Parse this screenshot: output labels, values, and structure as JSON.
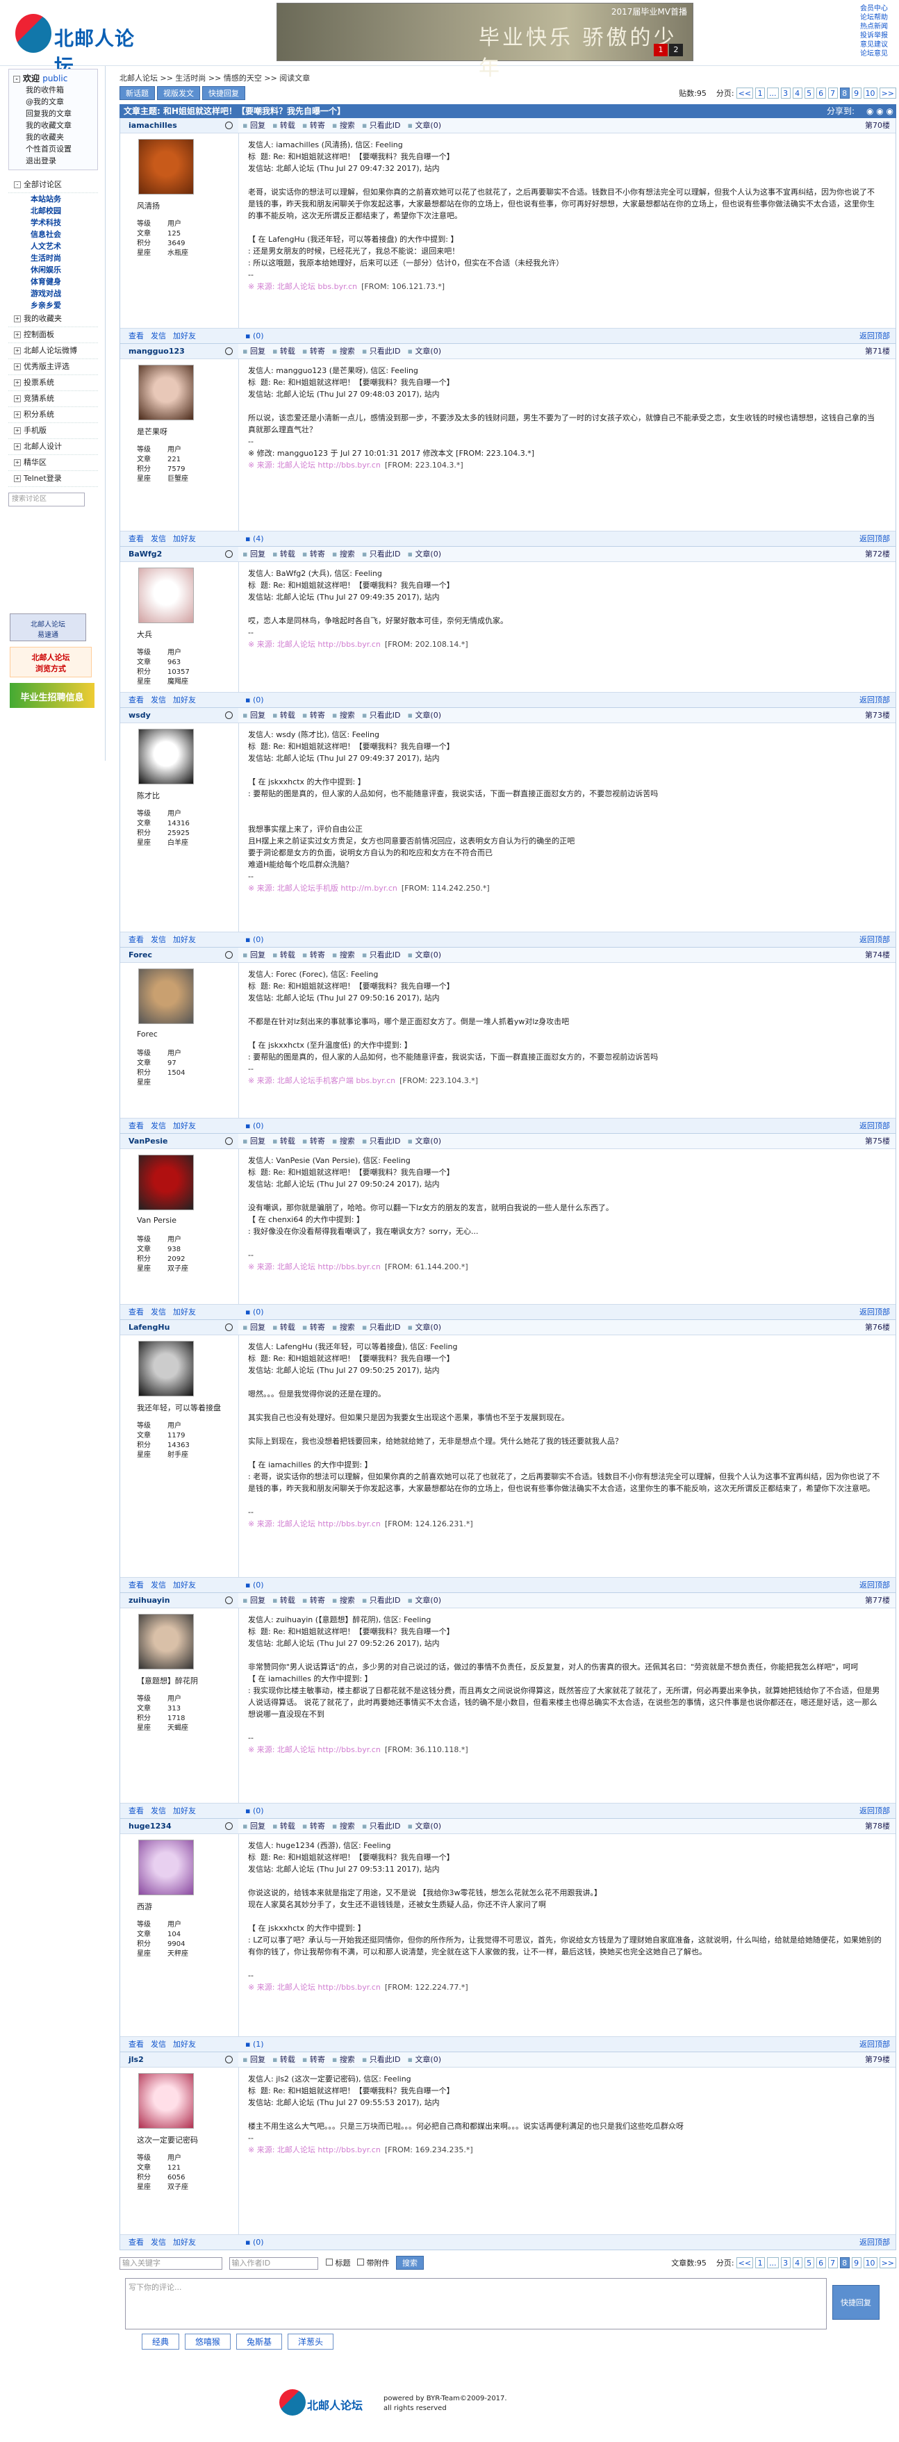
{
  "site": {
    "logo_text": "北邮人论坛",
    "banner_title": "毕业快乐  骄傲的少年",
    "banner_sub": "2017届毕业MV首播",
    "banner_p1": "1",
    "banner_p2": "2"
  },
  "toplinks": [
    "会员中心",
    "论坛帮助",
    "热点新闻",
    "投诉举报",
    "意见建议",
    "论坛意见"
  ],
  "side": {
    "welcome": "欢迎",
    "user": "public",
    "links": [
      "我的收件箱",
      "@我的文章",
      "回复我的文章",
      "我的收藏文章",
      "我的收藏夹",
      "个性首页设置",
      "退出登录"
    ],
    "all": "全部讨论区",
    "subs": [
      "本站站务",
      "北邮校园",
      "学术科技",
      "信息社会",
      "人文艺术",
      "生活时尚",
      "休闲娱乐",
      "体育健身",
      "游戏对战",
      "乡亲乡爱"
    ],
    "sections": [
      "我的收藏夹",
      "控制面板",
      "北邮人论坛微博",
      "优秀版主评选",
      "投票系统",
      "竞猜系统",
      "积分系统",
      "手机版",
      "北邮人设计",
      "精华区",
      "Telnet登录"
    ],
    "search_ph": "搜索讨论区",
    "promo1": "北邮人论坛\n易速通",
    "promo2": "北邮人论坛\n浏览方式",
    "promo3": "毕业生招聘信息"
  },
  "crumb": "北邮人论坛  >>  生活时尚  >>  情感的天空  >>  阅读文章",
  "toolbar": {
    "b1": "新话题",
    "b2": "视版发文",
    "b3": "快捷回复",
    "count": "贴数:95",
    "pages_label": "分页:",
    "pages": [
      "<<",
      "1",
      "...",
      "3",
      "4",
      "5",
      "6",
      "7",
      "8",
      "9",
      "10",
      ">>"
    ]
  },
  "title": {
    "text": "文章主题: 和H姐姐就这样吧！【要嘲我料？我先自曝一个】",
    "share": "分享到:"
  },
  "actions": [
    "回复",
    "转载",
    "转寄",
    "搜索",
    "只看此ID",
    "文章(0)"
  ],
  "footer_actions": [
    "查看",
    "发信",
    "加好友"
  ],
  "back": "返回顶部",
  "posts": [
    {
      "name": "iamachilles",
      "floor": "第70楼",
      "nick": "风清扬",
      "level": "用户",
      "posts": "125",
      "score": "3649",
      "star": "水瓶座",
      "fav": "(0)",
      "text": "发信人: iamachilles (风清扬), 信区: Feeling\n标  题: Re: 和H姐姐就这样吧！【要嘲我料？我先自曝一个】\n发信站: 北邮人论坛 (Thu Jul 27 09:47:32 2017), 站内\n\n老哥，说实话你的想法可以理解，但如果你真的之前喜欢她可以花了也就花了，之后再要聊实不合适。钱数目不小你有想法完全可以理解，但我个人认为这事不宜再纠结，因为你也说了不是钱的事，昨天我和朋友闲聊关于你发起这事，大家最想都站在你的立场上，但也说有些事，你可再好好想想，大家最想都站在你的立场上，但也说有些事你做法确实不太合适，这里你生的事不能反响，这次无所谓反正都结束了，希望你下次注意吧。\n\n【 在 LafengHu (我还年轻，可以等着接盘) 的大作中提到: 】\n: 还是男女朋友的时候，已经花光了，我总不能说：退回来吧！\n: 所以这哦题，我原本给她理好，后来可以还（一部分）估计0，但实在不合适（未经我允许）\n--",
      "src": "※ 来源: 北邮人论坛 bbs.byr.cn",
      "ip": "[FROM: 106.121.73.*]"
    },
    {
      "name": "mangguo123",
      "floor": "第71楼",
      "nick": "是芒果呀",
      "level": "用户",
      "posts": "221",
      "score": "7579",
      "star": "巨蟹座",
      "fav": "(4)",
      "text": "发信人: mangguo123 (是芒果呀), 信区: Feeling\n标  题: Re: 和H姐姐就这样吧！【要嘲我料？我先自曝一个】\n发信站: 北邮人论坛 (Thu Jul 27 09:48:03 2017), 站内\n\n所以说，该恋爱还是小清新一点儿，感情没到那一步，不要涉及太多的钱财问题，男生不要为了一时的讨女孩子欢心，就慷自己不能承受之恋，女生收钱的时候也请想想，这钱自己拿的当真就那么理直气壮？\n--\n※ 修改: mangguo123 于 Jul 27 10:01:31 2017 修改本文 [FROM: 223.104.3.*]",
      "src": "※ 来源: 北邮人论坛 http://bbs.byr.cn",
      "ip": "[FROM: 223.104.3.*]"
    },
    {
      "name": "BaWfg2",
      "floor": "第72楼",
      "nick": "大兵",
      "level": "用户",
      "posts": "963",
      "score": "10357",
      "star": "魔羯座",
      "fav": "(0)",
      "text": "发信人: BaWfg2 (大兵), 信区: Feeling\n标  题: Re: 和H姐姐就这样吧！【要嘲我料？我先自曝一个】\n发信站: 北邮人论坛 (Thu Jul 27 09:49:35 2017), 站内\n\n哎，恋人本是同林鸟，争啥起时各自飞，好聚好散本可佳，奈何无情成仇家。\n--",
      "src": "※ 来源: 北邮人论坛 http://bbs.byr.cn",
      "ip": "[FROM: 202.108.14.*]"
    },
    {
      "name": "wsdy",
      "floor": "第73楼",
      "nick": "陈才比",
      "level": "用户",
      "posts": "14316",
      "score": "25925",
      "star": "白羊座",
      "fav": "(0)",
      "text": "发信人: wsdy (陈才比), 信区: Feeling\n标  题: Re: 和H姐姐就这样吧！【要嘲我料？我先自曝一个】\n发信站: 北邮人论坛 (Thu Jul 27 09:49:37 2017), 站内\n\n【 在 jskxxhctx 的大作中提到: 】\n: 要帮贴的图是真的，但人家的人品如何，也不能随意评查，我说实话，下面一群直接正面怼女方的，不要忽视前边诉苦吗\n\n\n我想事实摆上来了，评价自由公正\n且H摆上来之前证实过女方贵足，女方也同意要否前情况回应，这表明女方自认为行的确坐的正吧\n要于洞论都是女方的负面，说明女方自认为的和吃应和女方在不符合而已\n难道H能给每个吃瓜群众洗脑？\n--",
      "src": "※ 来源: 北邮人论坛手机版 http://m.byr.cn",
      "ip": "[FROM: 114.242.250.*]"
    },
    {
      "name": "Forec",
      "floor": "第74楼",
      "nick": "Forec",
      "level": "用户",
      "posts": "97",
      "score": "1504",
      "star": "",
      "fav": "(0)",
      "text": "发信人: Forec (Forec), 信区: Feeling\n标  题: Re: 和H姐姐就这样吧！【要嘲我料？我先自曝一个】\n发信站: 北邮人论坛 (Thu Jul 27 09:50:16 2017), 站内\n\n不都是在针对lz刻出来的事就事论事吗，哪个是正面怼女方了。倒是一堆人抓着yw对lz身攻击吧\n\n【 在 jskxxhctx (至升温度低) 的大作中提到: 】\n: 要帮贴的图是真的，但人家的人品如何，也不能随意评查，我说实话，下面一群直接正面怼女方的，不要忽视前边诉苦吗\n--",
      "src": "※ 来源: 北邮人论坛手机客户端 bbs.byr.cn",
      "ip": "[FROM: 223.104.3.*]"
    },
    {
      "name": "VanPesie",
      "floor": "第75楼",
      "nick": "Van Persie",
      "level": "用户",
      "posts": "938",
      "score": "2092",
      "star": "双子座",
      "fav": "(0)",
      "text": "发信人: VanPesie (Van Persie), 信区: Feeling\n标  题: Re: 和H姐姐就这样吧！【要嘲我料？我先自曝一个】\n发信站: 北邮人论坛 (Thu Jul 27 09:50:24 2017), 站内\n\n没有嘲讽，那你就是骗朋了，哈哈。你可以翻一下lz女方的朋友的发言，就明白我说的一些人是什么东西了。\n【 在 chenxi64 的大作中提到: 】\n: 我好像没在你没看帮得我看嘲讽了，我在嘲讽女方？sorry，无心...\n\n--",
      "src": "※ 来源: 北邮人论坛 http://bbs.byr.cn",
      "ip": "[FROM: 61.144.200.*]"
    },
    {
      "name": "LafengHu",
      "floor": "第76楼",
      "nick": "我还年轻，可以等着接盘",
      "level": "用户",
      "posts": "1179",
      "score": "14363",
      "star": "射手座",
      "fav": "(0)",
      "text": "发信人: LafengHu (我还年轻，可以等着接盘), 信区: Feeling\n标  题: Re: 和H姐姐就这样吧！【要嘲我料？我先自曝一个】\n发信站: 北邮人论坛 (Thu Jul 27 09:50:25 2017), 站内\n\n嗯然。。。但是我觉得你说的还是在理的。\n\n其实我自己也没有处理好。但如果只是因为我要女生出现这个恶果，事情也不至于发展到现在。\n\n实际上到现在，我也没想着把钱要回来，给她就给她了，无非是想点个理。凭什么她花了我的钱还要就我人品？\n\n【 在 iamachilles 的大作中提到: 】\n: 老哥，说实话你的想法可以理解，但如果你真的之前喜欢她可以花了也就花了，之后再要聊实不合适。钱数目不小你有想法完全可以理解，但我个人认为这事不宜再纠结，因为你也说了不是钱的事，昨天我和朋友闲聊关于你发起这事，大家最想都站在你的立场上，但也说有些事你做法确实不太合适，这里你生的事不能反响，这次无所谓反正都结束了，希望你下次注意吧。\n\n--",
      "src": "※ 来源: 北邮人论坛 http://bbs.byr.cn",
      "ip": "[FROM: 124.126.231.*]"
    },
    {
      "name": "zuihuayin",
      "floor": "第77楼",
      "nick": "【意题想】醉花阴",
      "level": "用户",
      "posts": "313",
      "score": "1718",
      "star": "天蝎座",
      "fav": "(0)",
      "text": "发信人: zuihuayin (【意题想】醉花阴), 信区: Feeling\n标  题: Re: 和H姐姐就这样吧！【要嘲我料？我先自曝一个】\n发信站: 北邮人论坛 (Thu Jul 27 09:52:26 2017), 站内\n\n非常赞同你\"男人说话算话\"的点，多少男的对自己说过的话，做过的事情不负责任，反反复复，对人的伤害真的很大。还佩其名曰：\"劳资就是不想负责任，你能把我怎么样吧\"，呵呵\n【 在 iamachilles 的大作中提到: 】\n: 我实现你比楼主敏事动，楼主都说了日都花就不是这钱分费，而且再女之间说说你得算这，既然答应了大家就花了就花了，无所谓，何必再要出来争执，就算她把钱给你了不合适，但是男人说话得算话。 说花了就花了，此时再要她还事情买不太合适，钱的确不是小数目，但看来楼主也得总确实不太合适，在说些怎的事情，这只件事是也说你都还在，嗯还是好话，这一那么想说哪一直没现在不到\n\n--",
      "src": "※ 来源: 北邮人论坛 http://bbs.byr.cn",
      "ip": "[FROM: 36.110.118.*]"
    },
    {
      "name": "huge1234",
      "floor": "第78楼",
      "nick": "西游",
      "level": "用户",
      "posts": "104",
      "score": "9904",
      "star": "天秤座",
      "fav": "(1)",
      "text": "发信人: huge1234 (西游), 信区: Feeling\n标  题: Re: 和H姐姐就这样吧！【要嘲我料？我先自曝一个】\n发信站: 北邮人论坛 (Thu Jul 27 09:53:11 2017), 站内\n\n你说这说的，给钱本来就是指定了用途，又不是说 【我给你3w零花钱，想怎么花就怎么花不用跟我讲。】\n现在人家莫名其妙分手了，女生还不退钱钱是，还被女生质疑人品，你还不许人家问了啊\n\n【 在 jskxxhctx 的大作中提到: 】\n: LZ可以事了吧？承认与一开始我还挺同情你，但你的所作所为，让我觉得不可思议，首先，你说给女方钱是为了理财她自家庭准备，这就说明，什么叫给，给就是给她随便花，如果她别的有你的钱了，你让我帮你有不满，可以和那人说清楚，完全就在这下人家做的我，让不一样，最后这钱，换她买也完全这她自己了解也。\n\n--",
      "src": "※ 来源: 北邮人论坛 http://bbs.byr.cn",
      "ip": "[FROM: 122.224.77.*]"
    },
    {
      "name": "jls2",
      "floor": "第79楼",
      "nick": "这次一定要记密码",
      "level": "用户",
      "posts": "121",
      "score": "6056",
      "star": "双子座",
      "fav": "(0)",
      "text": "发信人: jls2 (这次一定要记密码), 信区: Feeling\n标  题: Re: 和H姐姐就这样吧！【要嘲我料？我先自曝一个】\n发信站: 北邮人论坛 (Thu Jul 27 09:55:53 2017), 站内\n\n楼主不用生这么大气吧。。。只是三万块而已啦。。。何必把自己商和都媒出来啊。。。说实话再便利满足的也只是我们这些吃瓜群众呀\n--",
      "src": "※ 来源: 北邮人论坛 http://bbs.byr.cn",
      "ip": "[FROM: 169.234.235.*]"
    }
  ],
  "bottom": {
    "search_ph1": "输入关键字",
    "search_ph2": "输入作者ID",
    "opt1": "标题",
    "opt2": "带附件",
    "btn": "搜索",
    "count": "文章数:95",
    "pages_label": "分页:"
  },
  "reply": {
    "placeholder": "写下你的评论...",
    "submit": "快捷回复",
    "emoji": [
      "经典",
      "悠嘻猴",
      "兔斯基",
      "洋葱头"
    ]
  },
  "foot": {
    "powered": "powered by BYR-Team©2009-2017.",
    "rights": "all rights reserved"
  },
  "label_level": "等级",
  "label_posts": "文章",
  "label_score": "积分",
  "label_star": "星座"
}
